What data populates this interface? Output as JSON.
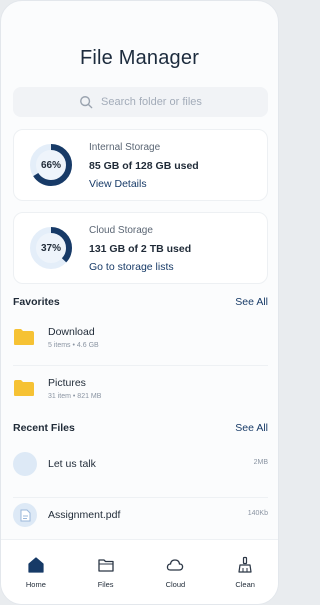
{
  "header": {
    "title": "File Manager"
  },
  "search": {
    "placeholder": "Search folder or files"
  },
  "storage": {
    "internal": {
      "percent_text": "66%",
      "percent": 66,
      "label": "Internal Storage",
      "used": "85 GB of 128 GB used",
      "link": "View Details"
    },
    "cloud": {
      "percent_text": "37%",
      "percent": 37,
      "label": "Cloud Storage",
      "used": "131 GB of 2 TB used",
      "link": "Go to storage lists"
    }
  },
  "favorites": {
    "title": "Favorites",
    "see_all": "See All",
    "items": [
      {
        "name": "Download",
        "meta": "5 items • 4.6 GB"
      },
      {
        "name": "Pictures",
        "meta": "31 item • 821 MB"
      }
    ]
  },
  "recent": {
    "title": "Recent Files",
    "see_all": "See All",
    "items": [
      {
        "name": "Let us talk",
        "size": "2MB"
      },
      {
        "name": "Assignment.pdf",
        "size": "140Kb"
      }
    ]
  },
  "nav": {
    "items": [
      {
        "label": "Home",
        "icon": "home-icon"
      },
      {
        "label": "Files",
        "icon": "folder-icon"
      },
      {
        "label": "Cloud",
        "icon": "cloud-icon"
      },
      {
        "label": "Clean",
        "icon": "broom-icon"
      }
    ]
  },
  "colors": {
    "accent": "#173a67",
    "ring_track": "#e4eef9",
    "ring_fill": "#173a67",
    "folder": "#f6c234"
  }
}
